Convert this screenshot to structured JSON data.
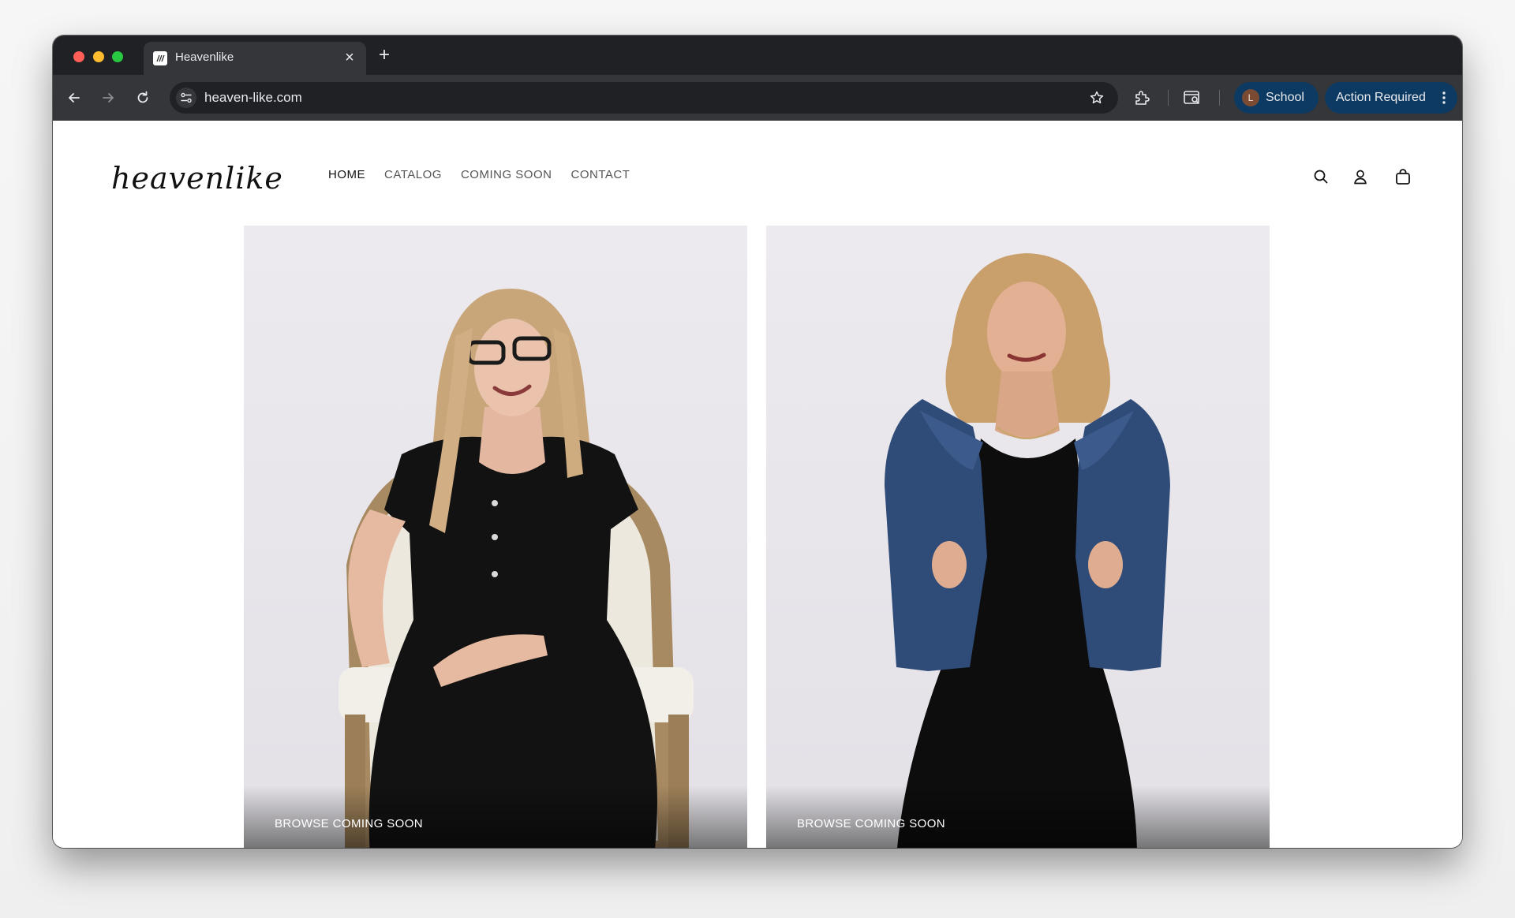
{
  "browser": {
    "tab_title": "Heavenlike",
    "tab_close": "×",
    "new_tab": "+",
    "url": "heaven-like.com",
    "profile": {
      "initial": "L",
      "label": "School"
    },
    "action_required": "Action Required",
    "icons": [
      "back-arrow-icon",
      "forward-arrow-icon",
      "reload-icon",
      "site-settings-icon",
      "bookmark-star-icon",
      "extensions-icon",
      "tab-search-icon",
      "more-vert-icon"
    ]
  },
  "site": {
    "logo": "heavenlike",
    "nav": [
      {
        "label": "HOME",
        "active": true
      },
      {
        "label": "CATALOG",
        "active": false
      },
      {
        "label": "COMING SOON",
        "active": false
      },
      {
        "label": "CONTACT",
        "active": false
      }
    ],
    "header_icons": [
      "search-icon",
      "account-icon",
      "shopping-bag-icon"
    ],
    "cards": [
      {
        "cta": "BROWSE COMING SOON"
      },
      {
        "cta": "BROWSE COMING SOON"
      }
    ]
  },
  "colors": {
    "chrome_dark": "#202124",
    "chrome_toolbar": "#35363a",
    "pill_blue": "#0d3a63",
    "text_dark": "#111111",
    "nav_text": "#555555"
  }
}
